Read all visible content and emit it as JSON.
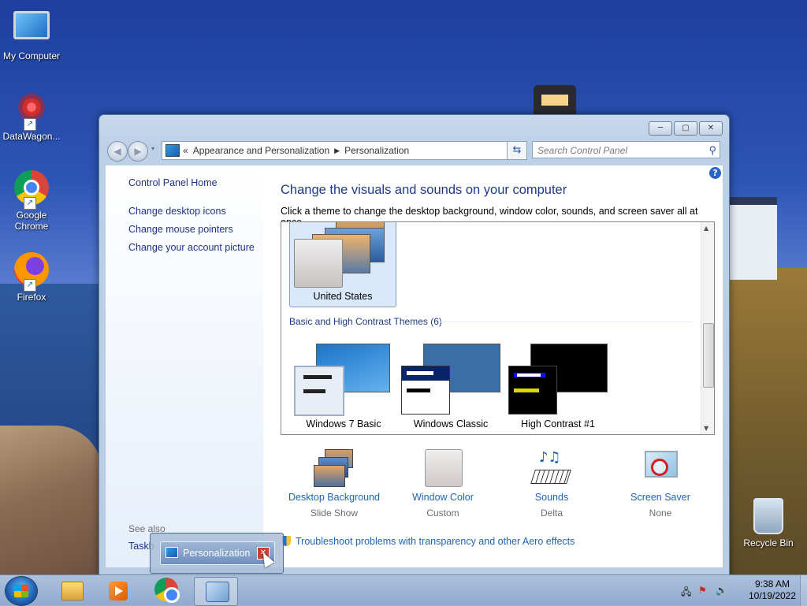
{
  "desktop": {
    "icons": [
      {
        "label": "My Computer"
      },
      {
        "label": "DataWagon..."
      },
      {
        "label_line1": "Google",
        "label_line2": "Chrome"
      },
      {
        "label": "Firefox"
      },
      {
        "label": "Recycle Bin"
      }
    ]
  },
  "window": {
    "buttons": {
      "minimize": "─",
      "maximize": "▢",
      "close": "✕"
    },
    "address": {
      "chevron": "«",
      "crumbs": [
        "Appearance and Personalization",
        "Personalization"
      ]
    },
    "search_placeholder": "Search Control Panel",
    "left_pane": {
      "links": [
        "Control Panel Home",
        "Change desktop icons",
        "Change mouse pointers",
        "Change your account picture"
      ],
      "see_also": "See also",
      "see_also_links": [
        "Taskb"
      ]
    },
    "main": {
      "heading": "Change the visuals and sounds on your computer",
      "subheading": "Click a theme to change the desktop background, window color, sounds, and screen saver all at once.",
      "selected_theme": "United States",
      "group_title": "Basic and High Contrast Themes (6)",
      "themes": [
        "Windows 7 Basic",
        "Windows Classic",
        "High Contrast #1"
      ],
      "settings": [
        {
          "label": "Desktop Background",
          "value": "Slide Show"
        },
        {
          "label": "Window Color",
          "value": "Custom"
        },
        {
          "label": "Sounds",
          "value": "Delta"
        },
        {
          "label": "Screen Saver",
          "value": "None"
        }
      ],
      "troubleshoot_link": "Troubleshoot problems with transparency and other Aero effects"
    }
  },
  "taskbar_preview": {
    "label": "Personalization"
  },
  "taskbar": {
    "clock_time": "9:38 AM",
    "clock_date": "10/19/2022"
  },
  "colors": {
    "link": "#1e64b4",
    "heading": "#1e3a8a",
    "left_link": "#1e3287"
  }
}
